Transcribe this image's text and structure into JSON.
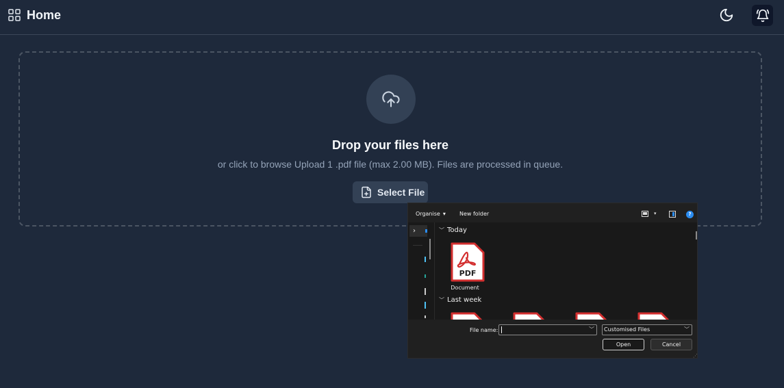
{
  "header": {
    "title": "Home"
  },
  "dropzone": {
    "title": "Drop your files here",
    "subtitle": "or click to browse Upload 1 .pdf file (max 2.00 MB). Files are processed in queue.",
    "select_label": "Select File"
  },
  "file_dialog": {
    "toolbar": {
      "organise_label": "Organise",
      "new_folder_label": "New folder",
      "help_label": "?"
    },
    "groups": [
      {
        "label": "Today",
        "files": [
          {
            "badge": "PDF",
            "name": "Document"
          }
        ]
      },
      {
        "label": "Last week"
      }
    ],
    "footer": {
      "file_name_label": "File name:",
      "file_name_value": "",
      "file_type_selected": "Customised Files",
      "open_label": "Open",
      "cancel_label": "Cancel"
    },
    "colors": {
      "pdf_red": "#d32f2f",
      "accent_blue": "#2b8cf0"
    }
  }
}
